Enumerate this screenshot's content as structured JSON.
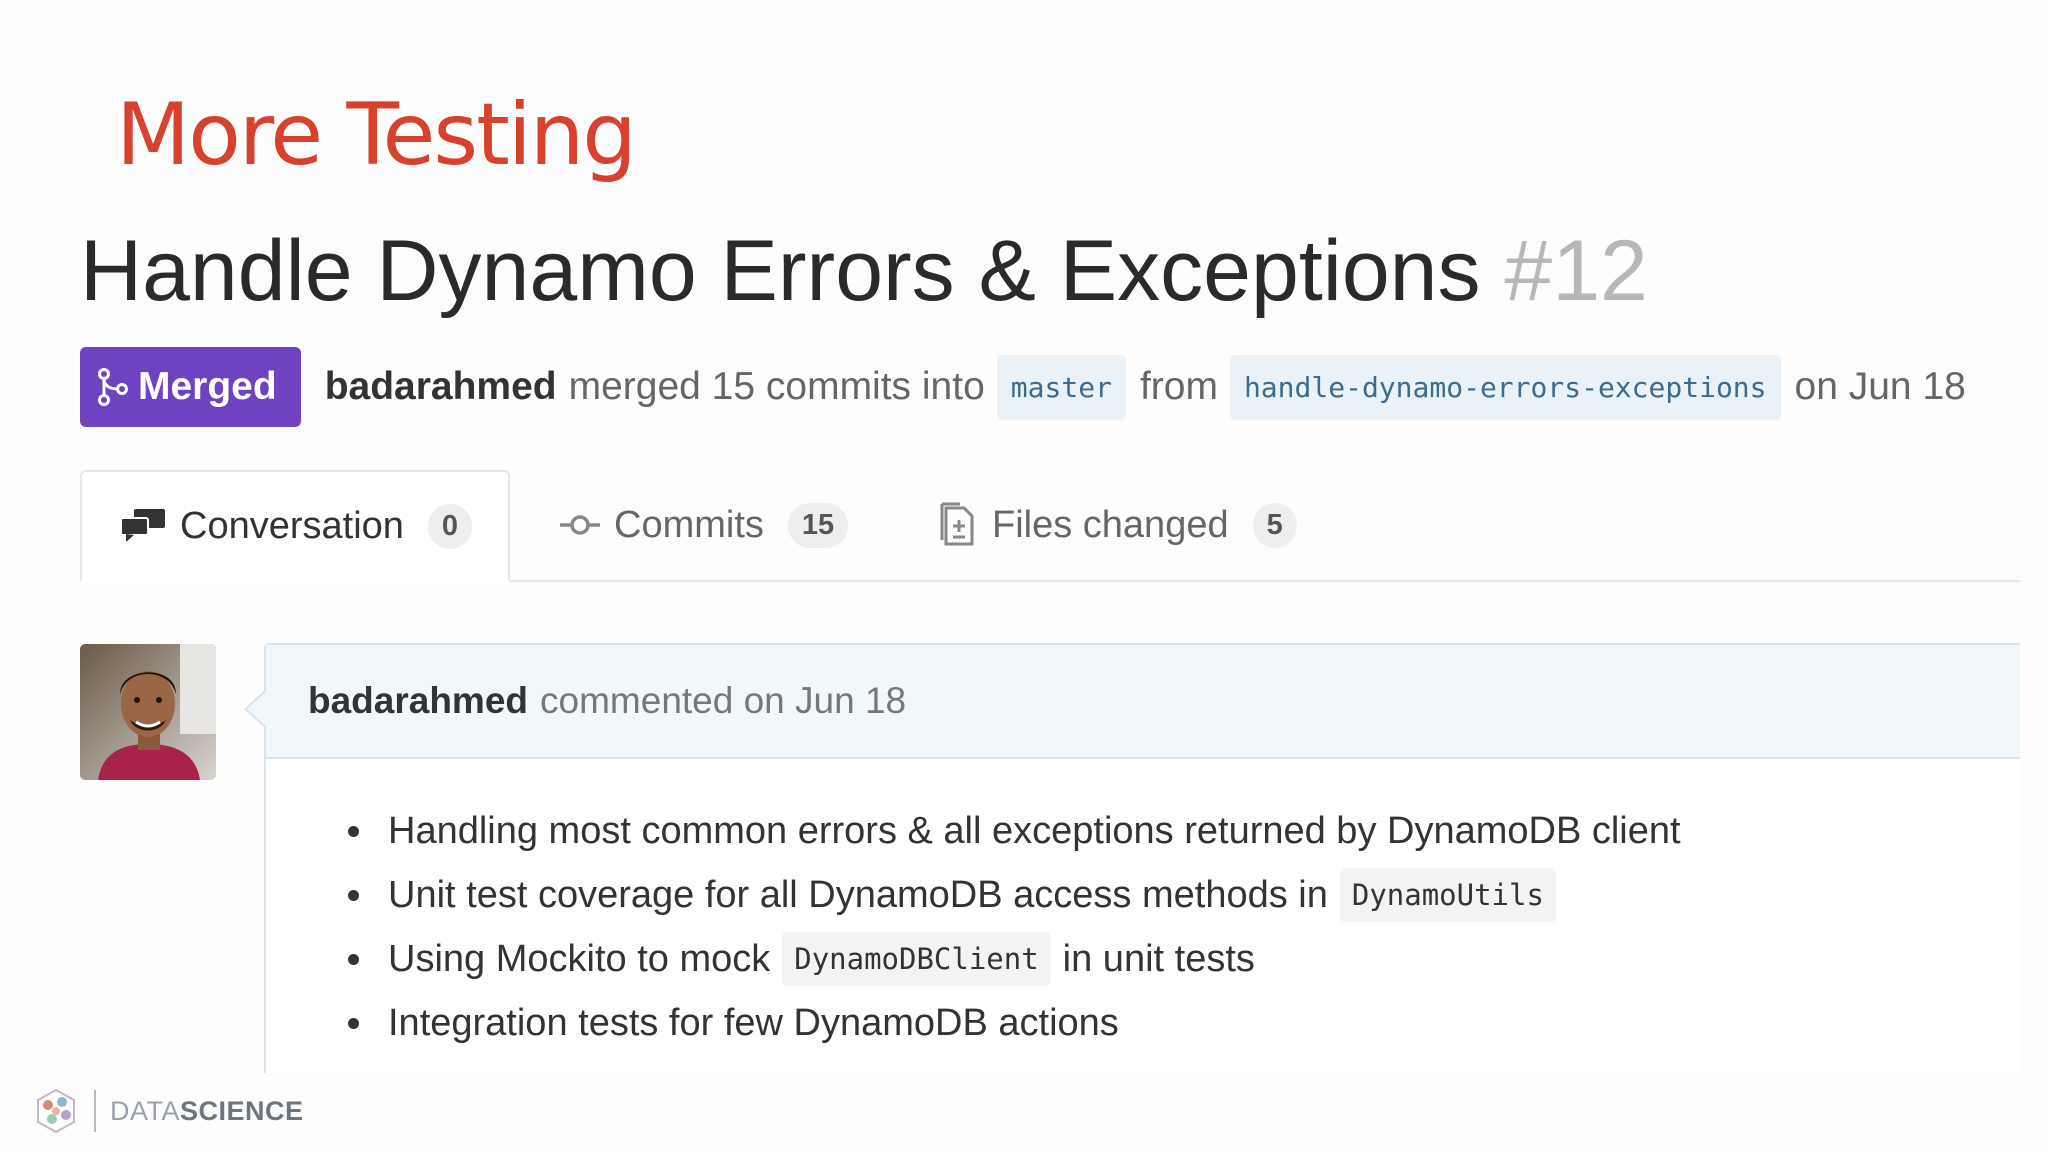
{
  "slide": {
    "heading": "More Testing"
  },
  "pull_request": {
    "title": "Handle Dynamo Errors & Exceptions",
    "number": "#12",
    "status": "Merged",
    "status_color": "#6f42c1",
    "author": "badarahmed",
    "action_text": "merged 15 commits into",
    "base_branch": "master",
    "from_text": "from",
    "head_branch": "handle-dynamo-errors-exceptions",
    "date_text": "on Jun 18"
  },
  "tabs": [
    {
      "label": "Conversation",
      "count": "0",
      "icon": "comment-discussion-icon",
      "active": true
    },
    {
      "label": "Commits",
      "count": "15",
      "icon": "git-commit-icon",
      "active": false
    },
    {
      "label": "Files changed",
      "count": "5",
      "icon": "file-diff-icon",
      "active": false
    }
  ],
  "comment": {
    "author": "badarahmed",
    "meta": "commented on Jun 18",
    "items": [
      {
        "text": "Handling most common errors & all exceptions returned by DynamoDB client"
      },
      {
        "before": "Unit test coverage for all DynamoDB access methods in",
        "code": "DynamoUtils"
      },
      {
        "before": "Using Mockito to mock",
        "code": "DynamoDBClient",
        "after": "in unit tests"
      },
      {
        "text": "Integration tests for few DynamoDB actions"
      }
    ]
  },
  "footer": {
    "brand_light": "DATA",
    "brand_bold": "SCIENCE",
    "icon": "datascience-logo-icon"
  }
}
